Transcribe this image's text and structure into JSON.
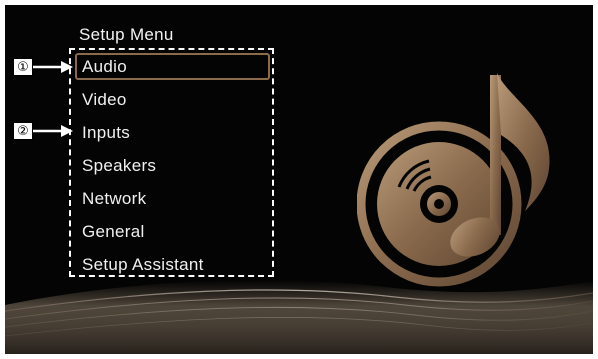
{
  "menu": {
    "title": "Setup Menu",
    "items": [
      {
        "label": "Audio",
        "selected": true
      },
      {
        "label": "Video",
        "selected": false
      },
      {
        "label": "Inputs",
        "selected": false
      },
      {
        "label": "Speakers",
        "selected": false
      },
      {
        "label": "Network",
        "selected": false
      },
      {
        "label": "General",
        "selected": false
      },
      {
        "label": "Setup Assistant",
        "selected": false
      }
    ]
  },
  "callouts": [
    {
      "label": "①",
      "target": "Audio"
    },
    {
      "label": "②",
      "target": "Inputs"
    }
  ],
  "logo": {
    "icon": "music-disc-icon",
    "color": "#8a6a4c"
  },
  "colors": {
    "background": "#040404",
    "text": "#f0f0f0",
    "accent": "#8b6b4a"
  }
}
